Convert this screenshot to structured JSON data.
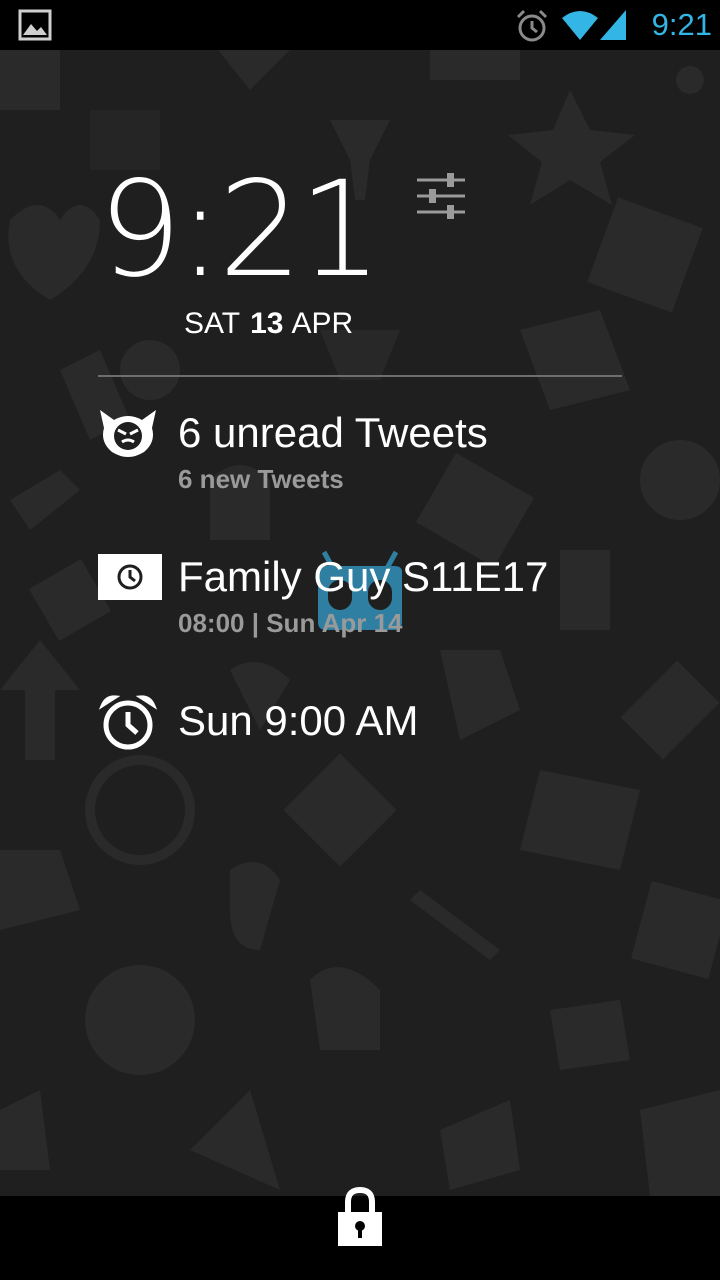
{
  "status_bar": {
    "time": "9:21",
    "time_color": "#33b5e5",
    "icons": [
      "gallery-icon",
      "alarm-icon",
      "wifi-icon",
      "signal-icon"
    ]
  },
  "lockscreen": {
    "clock": "9:21",
    "date": {
      "weekday": "SAT",
      "day": "13",
      "month": "APR"
    },
    "notifications": [
      {
        "icon": "twitter-bird-icon",
        "title": "6 unread Tweets",
        "subtitle": "6 new Tweets"
      },
      {
        "icon": "calendar-event-icon",
        "title": "Family Guy S11E17",
        "subtitle": "08:00 | Sun Apr 14"
      },
      {
        "icon": "alarm-clock-icon",
        "title": "Sun 9:00 AM"
      }
    ],
    "unlock_icon": "lock-icon"
  },
  "colors": {
    "background": "#1f1f1f",
    "accent": "#33b5e5",
    "subtext": "#9a9a9a"
  }
}
